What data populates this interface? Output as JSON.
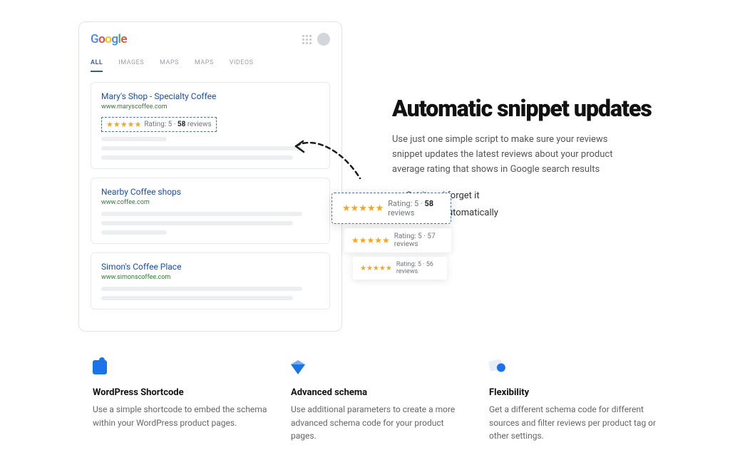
{
  "google": {
    "logo": "Google",
    "tabs": [
      "ALL",
      "IMAGES",
      "MAPS",
      "MAPS",
      "VIDEOS"
    ],
    "results": [
      {
        "title": "Mary's Shop - Specialty Coffee",
        "url": "www.maryscoffee.com",
        "rating_text": "Rating: 5 · ",
        "rating_count": "58",
        "rating_suffix": " reviews"
      },
      {
        "title": "Nearby Coffee shops",
        "url": "www.coffee.com"
      },
      {
        "title": "Simon's Coffee Place",
        "url": "www.simonscoffee.com"
      }
    ]
  },
  "floating": [
    {
      "rating_text": "Rating: 5 · ",
      "count": "58",
      "suffix": " reviews"
    },
    {
      "rating_text": "Rating: 5 · 57 reviews"
    },
    {
      "rating_text": "Rating: 5 · 56 reviews"
    }
  ],
  "hero": {
    "headline": "Automatic snippet updates",
    "desc": "Use just one simple script to make sure your reviews snippet updates the latest reviews about your product average rating that shows in Google search results",
    "checks": [
      "Set it and forget it",
      "Updates automatically"
    ]
  },
  "features": [
    {
      "title": "WordPress Shortcode",
      "text": "Use a simple shortcode to embed the schema within your WordPress product pages."
    },
    {
      "title": "Advanced schema",
      "text": "Use additional parameters to create a more advanced schema code for your product pages."
    },
    {
      "title": "Flexibility",
      "text": "Get a different schema code for different sources and filter reviews per product tag or other settings."
    }
  ]
}
